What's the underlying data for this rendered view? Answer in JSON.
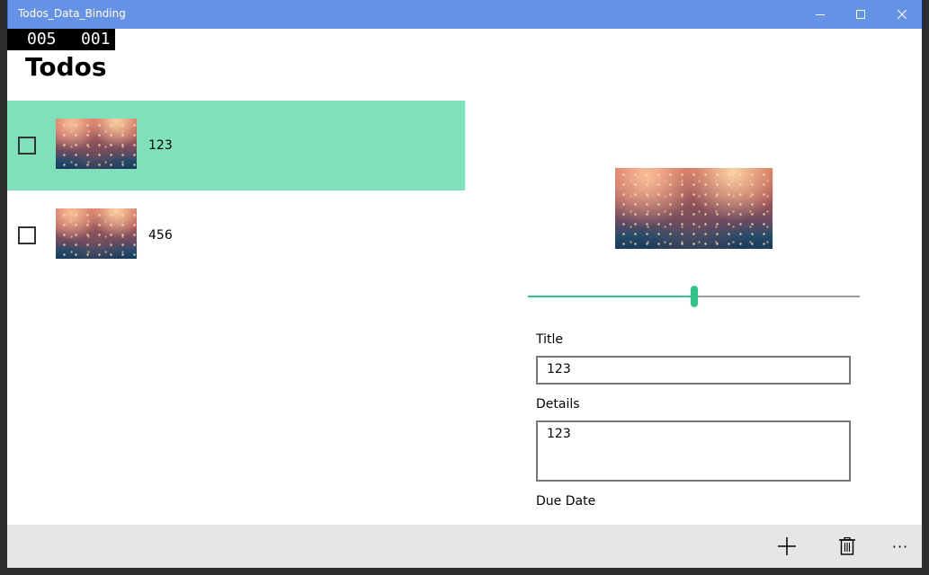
{
  "window": {
    "title": "Todos_Data_Binding"
  },
  "counter": {
    "left": "005",
    "right": "001"
  },
  "page": {
    "title": "Todos"
  },
  "todos": [
    {
      "label": "123",
      "checked": false,
      "selected": true
    },
    {
      "label": "456",
      "checked": false,
      "selected": false
    }
  ],
  "detail": {
    "slider_value": 0.5,
    "title_label": "Title",
    "title_value": "123",
    "details_label": "Details",
    "details_value": "123",
    "due_date_label": "Due Date"
  },
  "appbar": {
    "more_label": "···"
  },
  "colors": {
    "titlebar": "#6492e6",
    "selected_row": "#80e0bb",
    "accent": "#2fc487",
    "appbar": "#e6e6e6"
  },
  "icons": {
    "add": "plus-icon",
    "delete": "trash-icon",
    "more": "ellipsis-icon"
  }
}
